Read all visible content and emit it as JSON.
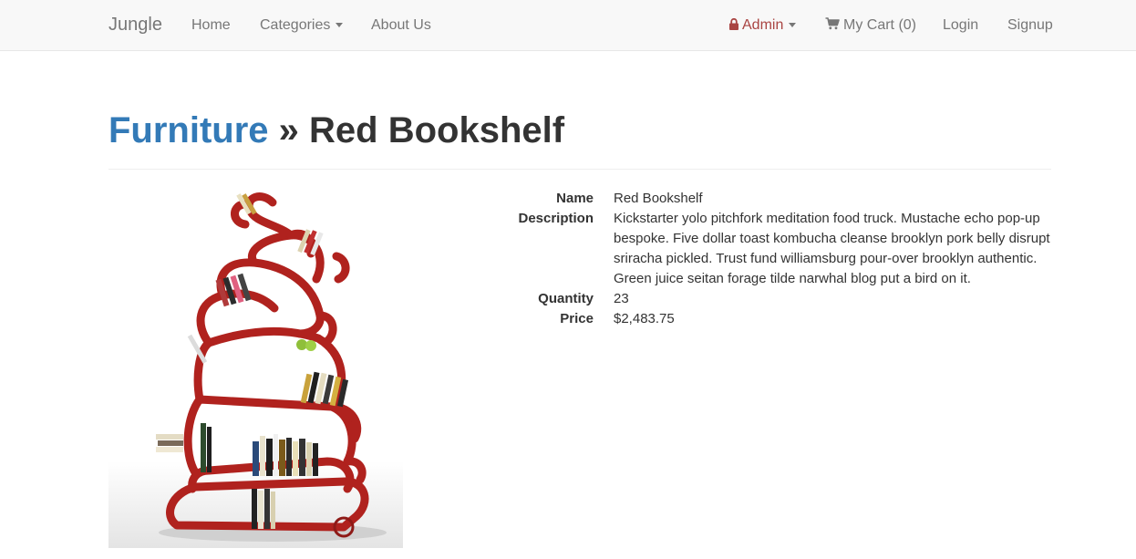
{
  "navbar": {
    "brand": "Jungle",
    "links": {
      "home": "Home",
      "categories": "Categories",
      "about": "About Us",
      "admin": "Admin",
      "cart": "My Cart (0)",
      "login": "Login",
      "signup": "Signup"
    },
    "icons": {
      "admin": "lock-icon",
      "cart": "shopping-cart-icon",
      "dropdown": "caret-down-icon"
    },
    "colors": {
      "admin": "#a94442",
      "background": "#f8f8f8"
    }
  },
  "header": {
    "category": "Furniture",
    "separator": "»",
    "product_name": "Red Bookshelf"
  },
  "product": {
    "image_alt": "Red Bookshelf",
    "fields": [
      {
        "label": "Name",
        "value": "Red Bookshelf"
      },
      {
        "label": "Description",
        "value": "Kickstarter yolo pitchfork meditation food truck. Mustache echo pop-up bespoke. Five dollar toast kombucha cleanse brooklyn pork belly disrupt sriracha pickled. Trust fund williamsburg pour-over brooklyn authentic. Green juice seitan forage tilde narwhal blog put a bird on it."
      },
      {
        "label": "Quantity",
        "value": "23"
      },
      {
        "label": "Price",
        "value": "$2,483.75"
      }
    ]
  },
  "colors": {
    "link": "#337ab7",
    "shelf": "#b0221e"
  }
}
